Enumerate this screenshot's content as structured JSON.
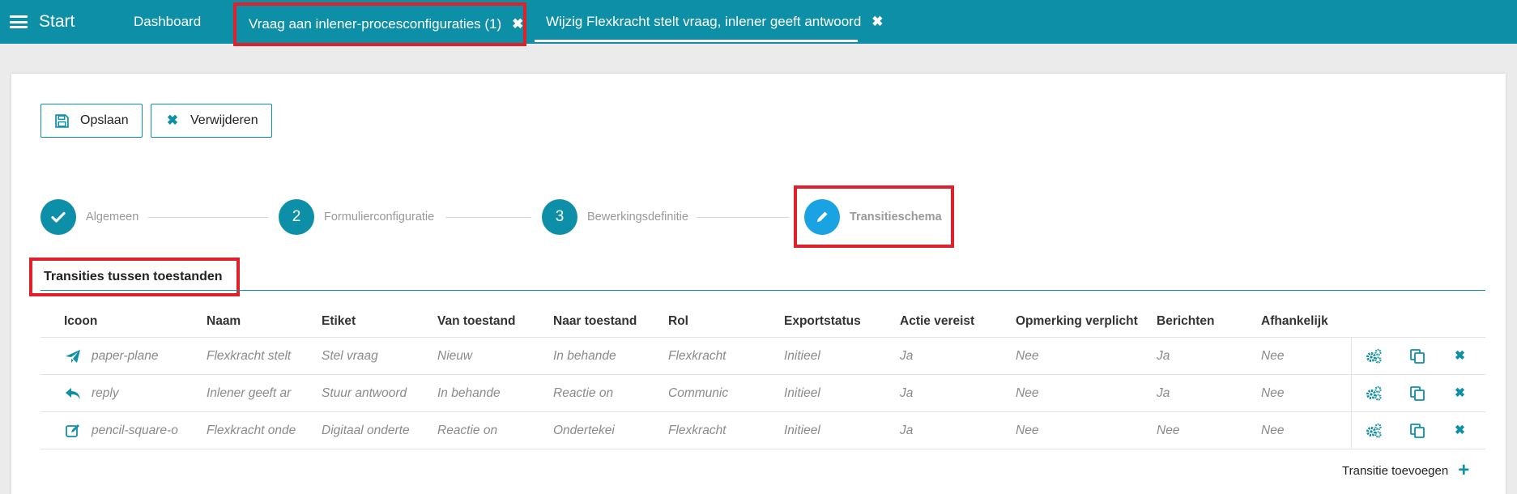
{
  "topbar": {
    "start_label": "Start",
    "tabs": [
      {
        "label": "Dashboard",
        "closable": false
      },
      {
        "label": "Vraag aan inlener-procesconfiguraties (1)",
        "closable": true
      },
      {
        "label": "Wijzig Flexkracht stelt vraag, inlener geeft antwoord",
        "closable": true
      }
    ],
    "close_glyph": "✖"
  },
  "toolbar": {
    "save_label": "Opslaan",
    "delete_label": "Verwijderen"
  },
  "steps": [
    {
      "label": "Algemeen",
      "marker": "✔",
      "state": "done"
    },
    {
      "label": "Formulierconfiguratie",
      "marker": "2",
      "state": "pending"
    },
    {
      "label": "Bewerkingsdefinitie",
      "marker": "3",
      "state": "pending"
    },
    {
      "label": "Transitieschema",
      "marker": "pencil-icon",
      "state": "active"
    }
  ],
  "section": {
    "title": "Transities tussen toestanden"
  },
  "table": {
    "headers": [
      "Icoon",
      "Naam",
      "Etiket",
      "Van toestand",
      "Naar toestand",
      "Rol",
      "Exportstatus",
      "Actie vereist",
      "Opmerking verplicht",
      "Berichten",
      "Afhankelijk"
    ],
    "rows": [
      {
        "icon": "paper-plane",
        "naam": "Flexkracht stelt",
        "etiket": "Stel vraag",
        "van": "Nieuw",
        "naar": "In behande",
        "rol": "Flexkracht",
        "export": "Initieel",
        "actie": "Ja",
        "opmerking": "Nee",
        "berichten": "Ja",
        "afhankelijk": "Nee"
      },
      {
        "icon": "reply",
        "naam": "Inlener geeft ar",
        "etiket": "Stuur antwoord",
        "van": "In behande",
        "naar": "Reactie on",
        "rol": "Communic",
        "export": "Initieel",
        "actie": "Ja",
        "opmerking": "Nee",
        "berichten": "Ja",
        "afhankelijk": "Nee"
      },
      {
        "icon": "pencil-square-o",
        "naam": "Flexkracht onde",
        "etiket": "Digitaal onderte",
        "van": "Reactie on",
        "naar": "Ondertekei",
        "rol": "Flexkracht",
        "export": "Initieel",
        "actie": "Ja",
        "opmerking": "Nee",
        "berichten": "Nee",
        "afhankelijk": "Nee"
      }
    ]
  },
  "add_transition_label": "Transitie toevoegen",
  "colors": {
    "brand": "#0e8fa8",
    "active_step": "#1aa3e3",
    "highlight": "#e0212b"
  }
}
